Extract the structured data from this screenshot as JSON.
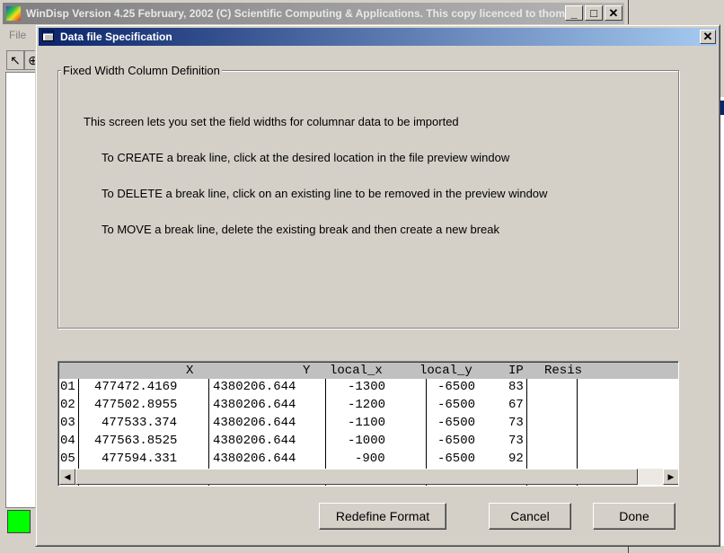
{
  "main_window": {
    "title": "WinDisp Version 4.25 February, 2002 (C) Scientific Computing & Applications. This copy licenced to thom...",
    "menu_file": "File",
    "minimize_glyph": "_",
    "maximize_glyph": "□",
    "close_glyph": "✕",
    "pointer_glyph": "↖",
    "tool2_glyph": "⊕",
    "status_color": "#00ff00"
  },
  "dialog": {
    "title": "Data file Specification",
    "close_glyph": "✕",
    "group_title": "Fixed Width Column Definition",
    "intro": "This screen lets you set the field widths for columnar data to be imported",
    "instructions": [
      "To CREATE a break line, click at the desired location in the file preview window",
      "To DELETE a break line, click on an existing line to be removed in the preview window",
      "To MOVE a break line, delete the existing break and then create a new break"
    ],
    "preview": {
      "headers": [
        "X",
        "Y",
        "local_x",
        "local_y",
        "IP",
        "Resis"
      ],
      "rows": [
        {
          "num": "01",
          "x": "477472.4169",
          "y": "4380206.644",
          "local_x": "-1300",
          "local_y": "-6500",
          "ip": "83"
        },
        {
          "num": "02",
          "x": "477502.8955",
          "y": "4380206.644",
          "local_x": "-1200",
          "local_y": "-6500",
          "ip": "67"
        },
        {
          "num": "03",
          "x": "477533.374",
          "y": "4380206.644",
          "local_x": "-1100",
          "local_y": "-6500",
          "ip": "73"
        },
        {
          "num": "04",
          "x": "477563.8525",
          "y": "4380206.644",
          "local_x": "-1000",
          "local_y": "-6500",
          "ip": "73"
        },
        {
          "num": "05",
          "x": "477594.331",
          "y": "4380206.644",
          "local_x": "-900",
          "local_y": "-6500",
          "ip": "92"
        }
      ],
      "scroll_up_glyph": "▲",
      "scroll_down_glyph": "▼",
      "scroll_left_glyph": "◀",
      "scroll_right_glyph": "▶"
    },
    "buttons": {
      "redefine": "Redefine Format",
      "cancel": "Cancel",
      "done": "Done"
    }
  }
}
